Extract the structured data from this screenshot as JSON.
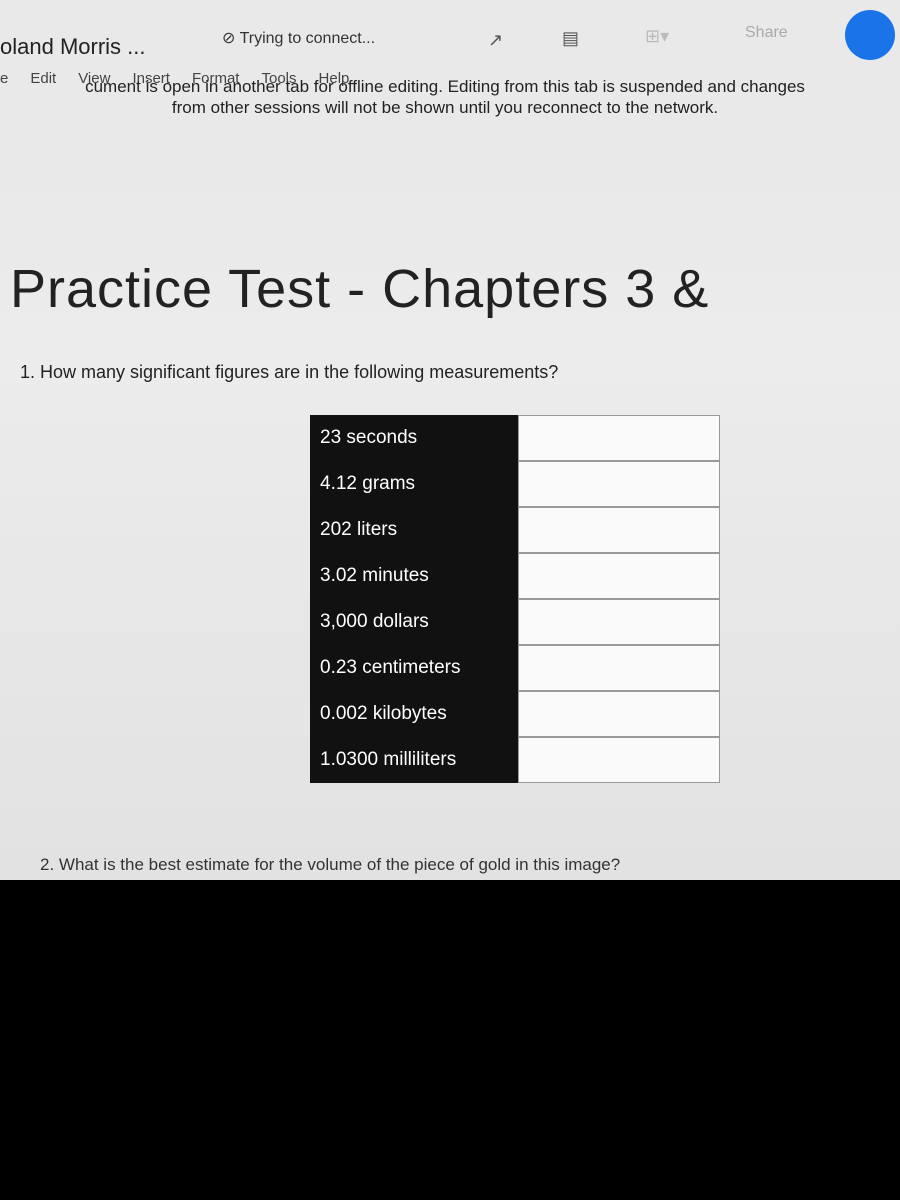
{
  "header": {
    "doc_title": "oland Morris ...",
    "status": "Trying to connect...",
    "share_label": "Share"
  },
  "menu": [
    "e",
    "Edit",
    "View",
    "Insert",
    "Format",
    "Tools",
    "Help"
  ],
  "banner": {
    "line1": "cument is open in another tab for offline editing. Editing from this tab is suspended and changes",
    "line2": "from other sessions will not be shown until you reconnect to the network."
  },
  "doc": {
    "title": "Practice Test - Chapters 3 &",
    "question1": "1.  How many significant figures are in the following measurements?",
    "measurements": [
      "23 seconds",
      "4.12 grams",
      "202 liters",
      "3.02 minutes",
      "3,000 dollars",
      "0.23 centimeters",
      "0.002 kilobytes",
      "1.0300 milliliters"
    ],
    "question2": "2.   What is the best estimate for the volume of the piece of gold in this image?"
  },
  "colors": {
    "accent": "#1a73e8"
  }
}
